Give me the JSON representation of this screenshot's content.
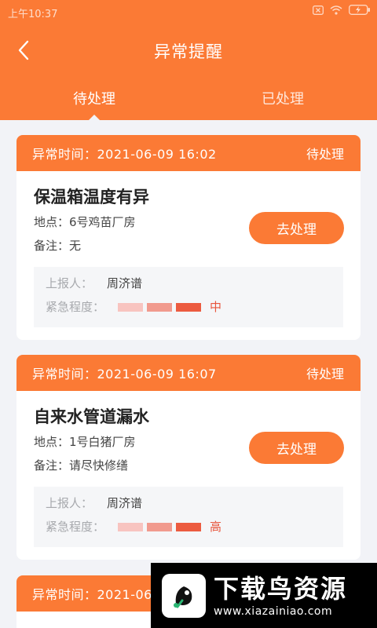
{
  "status_bar": {
    "time": "上午10:37"
  },
  "nav": {
    "title": "异常提醒"
  },
  "tabs": [
    {
      "label": "待处理",
      "active": true
    },
    {
      "label": "已处理",
      "active": false
    }
  ],
  "colors": {
    "accent": "#fb7a35",
    "urgency_bar_1": "#f8c4c0",
    "urgency_bar_2": "#f19a8e",
    "urgency_bar_3": "#ec5b40",
    "urgency_text": "#e8553c"
  },
  "cards": [
    {
      "time_label": "异常时间：2021-06-09 16:02",
      "status": "待处理",
      "title": "保温箱温度有异",
      "location": "地点：6号鸡苗厂房",
      "note": "备注：无",
      "action_label": "去处理",
      "reporter_label": "上报人：",
      "reporter": "周济谱",
      "urgency_label": "紧急程度：",
      "urgency": "中"
    },
    {
      "time_label": "异常时间：2021-06-09 16:07",
      "status": "待处理",
      "title": "自来水管道漏水",
      "location": "地点：1号白猪厂房",
      "note": "备注：请尽快修缮",
      "action_label": "去处理",
      "reporter_label": "上报人：",
      "reporter": "周济谱",
      "urgency_label": "紧急程度：",
      "urgency": "高"
    },
    {
      "time_label": "异常时间：2021-06",
      "status": "",
      "title": "",
      "location": "",
      "note": "",
      "action_label": "",
      "reporter_label": "",
      "reporter": "",
      "urgency_label": "",
      "urgency": ""
    }
  ],
  "watermark": {
    "title": "下载鸟资源",
    "url": "www.xiazainiao.com"
  },
  "icons": [
    "back-arrow-icon",
    "close-box-icon",
    "wifi-icon",
    "battery-icon"
  ]
}
